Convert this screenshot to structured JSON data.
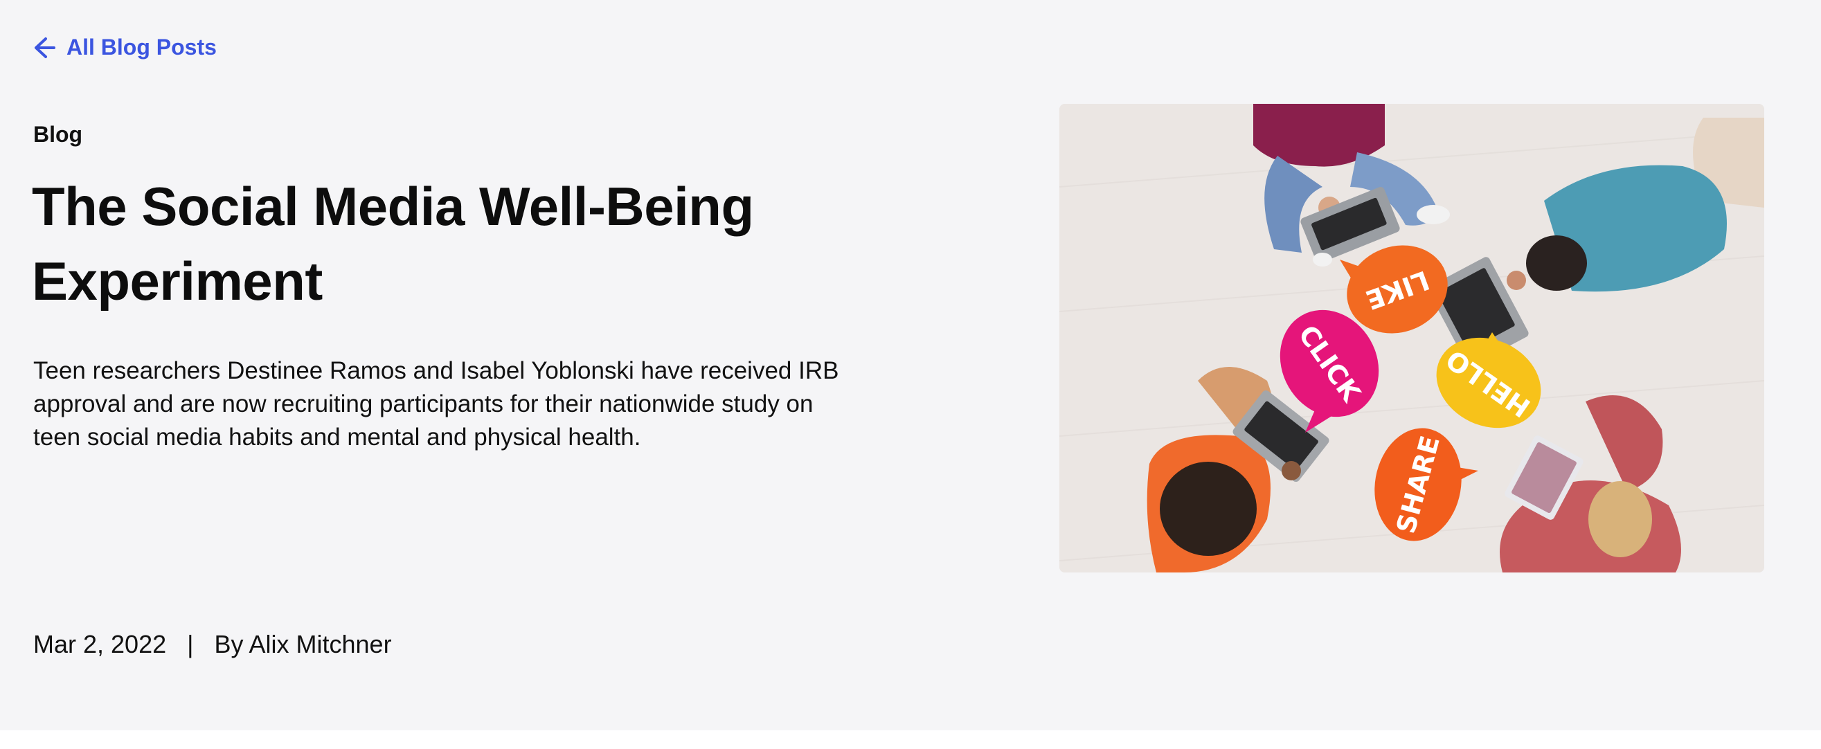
{
  "back_link": {
    "label": "All Blog Posts",
    "icon": "arrow-left-icon",
    "color": "#3b55e0"
  },
  "post": {
    "category": "Blog",
    "title": "The Social Media Well-Being Experiment",
    "summary": "Teen researchers Destinee Ramos and Isabel Yoblonski have received IRB approval and are now recruiting participants for their nationwide study on teen social media habits and mental and physical health.",
    "date": "Mar 2, 2022",
    "separator": "|",
    "author": "By Alix Mitchner"
  },
  "hero_image": {
    "bubbles": {
      "like": "LIKE",
      "click": "CLICK",
      "hello": "HELLO",
      "share": "SHARE"
    }
  },
  "colors": {
    "background": "#f5f5f7",
    "accent": "#3b55e0",
    "text": "#111111"
  }
}
